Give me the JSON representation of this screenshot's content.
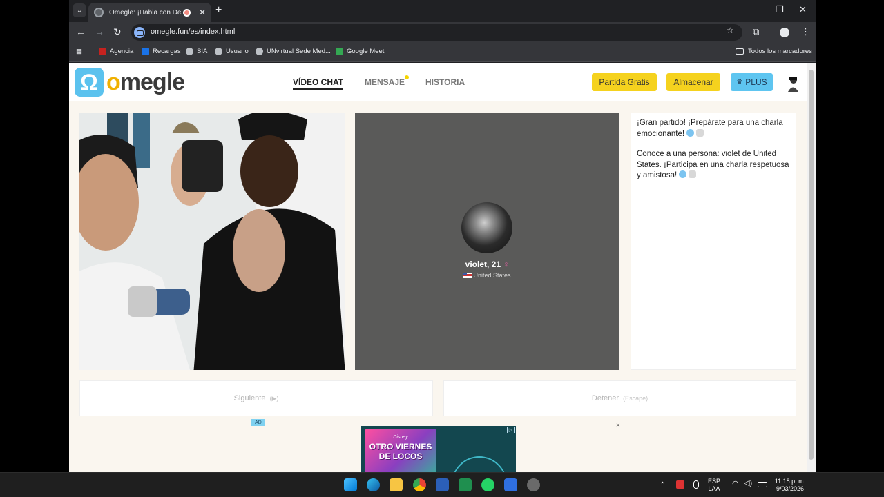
{
  "browser": {
    "tab": {
      "title": "Omegle: ¡Habla con Desconocidos!",
      "close": "✕"
    },
    "new_tab": "+",
    "window_controls": {
      "minimize": "—",
      "maximize": "❐",
      "close": "✕"
    },
    "url": "omegle.fun/es/index.html",
    "bookmarks": [
      {
        "label": "Agencia",
        "icon_color": "#c5221f"
      },
      {
        "label": "Recargas",
        "icon_color": "#1a73e8"
      },
      {
        "label": "SIA",
        "icon_color": "#bdc1c6"
      },
      {
        "label": "Usuario",
        "icon_color": "#bdc1c6"
      },
      {
        "label": "UNvirtual Sede Med...",
        "icon_color": "#bdc1c6"
      },
      {
        "label": "Google Meet",
        "icon_color": "#34a853"
      }
    ],
    "all_bookmarks": "Todos los marcadores"
  },
  "site": {
    "logo": {
      "mark": "Ω",
      "text_o": "o",
      "text_rest": "megle"
    },
    "nav": {
      "video_chat": "VÍDEO CHAT",
      "message": "MENSAJE",
      "history": "HISTORIA"
    },
    "buttons": {
      "free_match": "Partida Gratis",
      "store": "Almacenar",
      "plus": "PLUS",
      "plus_icon": "♛"
    }
  },
  "remote": {
    "name": "violet, 21",
    "gender_icon": "♀",
    "country": "United States"
  },
  "chat": {
    "line1": "¡Gran partido! ¡Prepárate para una charla emocionante!",
    "line2": "Conoce a una persona: violet de United States. ¡Participa en una charla respetuosa y amistosa!"
  },
  "actions": {
    "next": {
      "label": "Siguiente",
      "shortcut": "(▶)"
    },
    "stop": {
      "label": "Detener",
      "shortcut": "(Escape)"
    }
  },
  "ad": {
    "tag": "AD",
    "close": "×",
    "brand": "Disney",
    "title": "OTRO VIERNES DE LOCOS",
    "info": "▷"
  },
  "tray": {
    "lang": "ESP",
    "layout": "LAA",
    "time": "11:18 p. m.",
    "date": "9/03/2026"
  },
  "colors": {
    "accent_yellow": "#f5d21e",
    "accent_blue": "#5ec5f0",
    "remote_bg": "#5a5a59",
    "page_bg": "#faf6ef"
  }
}
